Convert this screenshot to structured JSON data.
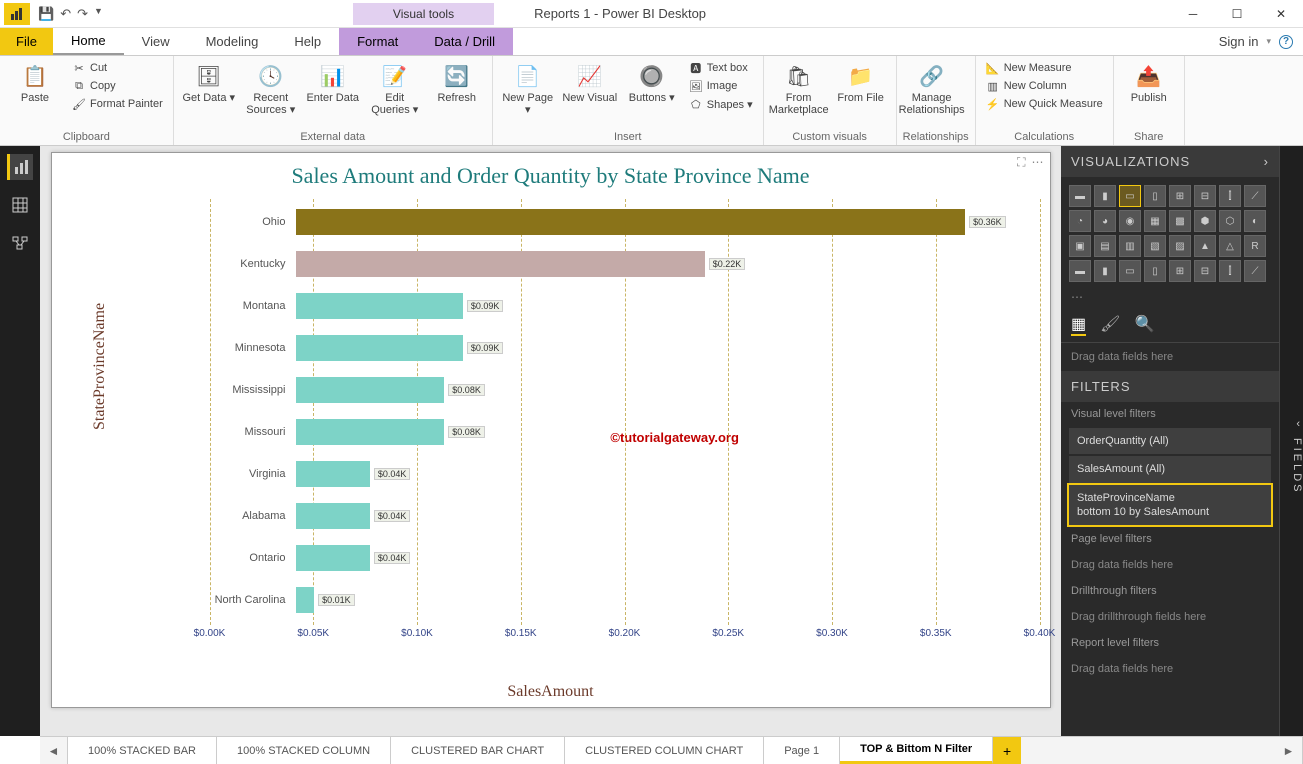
{
  "window": {
    "title": "Reports 1 - Power BI Desktop",
    "visual_tools": "Visual tools",
    "sign_in": "Sign in"
  },
  "tabs": {
    "file": "File",
    "home": "Home",
    "view": "View",
    "modeling": "Modeling",
    "help": "Help",
    "format": "Format",
    "datadrill": "Data / Drill"
  },
  "ribbon": {
    "paste": "Paste",
    "cut": "Cut",
    "copy": "Copy",
    "format_painter": "Format Painter",
    "clipboard": "Clipboard",
    "get_data": "Get\nData ▾",
    "recent_sources": "Recent\nSources ▾",
    "enter_data": "Enter\nData",
    "edit_queries": "Edit\nQueries ▾",
    "refresh": "Refresh",
    "external_data": "External data",
    "new_page": "New\nPage ▾",
    "new_visual": "New\nVisual",
    "buttons": "Buttons\n▾",
    "text_box": "Text box",
    "image": "Image",
    "shapes": "Shapes ▾",
    "insert": "Insert",
    "from_marketplace": "From\nMarketplace",
    "from_file": "From\nFile",
    "custom_visuals": "Custom visuals",
    "manage_rel": "Manage\nRelationships",
    "relationships": "Relationships",
    "new_measure": "New Measure",
    "new_column": "New Column",
    "new_quick_measure": "New Quick Measure",
    "calculations": "Calculations",
    "publish": "Publish",
    "share": "Share"
  },
  "chart_data": {
    "type": "bar",
    "title": "Sales Amount and Order Quantity by State Province Name",
    "xlabel": "SalesAmount",
    "ylabel": "StateProvinceName",
    "xticks": [
      "$0.00K",
      "$0.05K",
      "$0.10K",
      "$0.15K",
      "$0.20K",
      "$0.25K",
      "$0.30K",
      "$0.35K",
      "$0.40K"
    ],
    "xmax": 0.4,
    "categories": [
      "Ohio",
      "Kentucky",
      "Montana",
      "Minnesota",
      "Mississippi",
      "Missouri",
      "Virginia",
      "Alabama",
      "Ontario",
      "North Carolina"
    ],
    "values": [
      0.36,
      0.22,
      0.09,
      0.09,
      0.08,
      0.08,
      0.04,
      0.04,
      0.04,
      0.01
    ],
    "data_labels": [
      "$0.36K",
      "$0.22K",
      "$0.09K",
      "$0.09K",
      "$0.08K",
      "$0.08K",
      "$0.04K",
      "$0.04K",
      "$0.04K",
      "$0.01K"
    ],
    "colors": [
      "#8a7319",
      "#c4aaa8",
      "#7dd3c7",
      "#7dd3c7",
      "#7dd3c7",
      "#7dd3c7",
      "#7dd3c7",
      "#7dd3c7",
      "#7dd3c7",
      "#7dd3c7"
    ]
  },
  "watermark": "©tutorialgateway.org",
  "page_tabs": [
    "100% STACKED BAR",
    "100% STACKED COLUMN",
    "CLUSTERED BAR CHART",
    "CLUSTERED COLUMN CHART",
    "Page 1",
    "TOP & Bittom N Filter"
  ],
  "active_page_tab": 5,
  "viz_pane": {
    "header": "VISUALIZATIONS",
    "drag_here": "Drag data fields here"
  },
  "filters": {
    "header": "FILTERS",
    "visual_level": "Visual level filters",
    "items": [
      {
        "label": "OrderQuantity  (All)"
      },
      {
        "label": "SalesAmount  (All)"
      },
      {
        "label": "StateProvinceName\nbottom 10 by SalesAmount",
        "highlight": true
      }
    ],
    "page_level": "Page level filters",
    "drag_page": "Drag data fields here",
    "drillthrough": "Drillthrough filters",
    "drag_drill": "Drag drillthrough fields here",
    "report_level": "Report level filters",
    "drag_report": "Drag data fields here"
  },
  "fields_tab": "FIELDS"
}
